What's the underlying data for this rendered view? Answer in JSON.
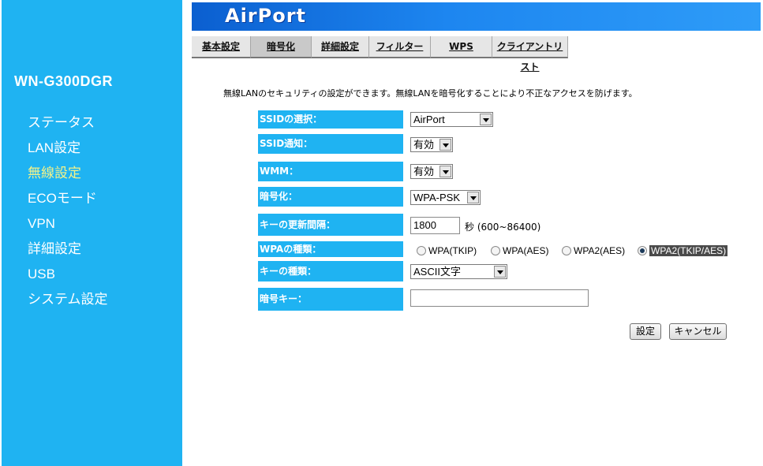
{
  "sidebar": {
    "model": "WN-G300DGR",
    "items": [
      {
        "label": "ステータス"
      },
      {
        "label": "LAN設定"
      },
      {
        "label": "無線設定"
      },
      {
        "label": "ECOモード"
      },
      {
        "label": "VPN"
      },
      {
        "label": "詳細設定"
      },
      {
        "label": "USB"
      },
      {
        "label": "システム設定"
      }
    ],
    "active_index": 2,
    "active_color": "#f2f28a",
    "background_color": "#1fb3f2"
  },
  "header": {
    "logo": "AirPort"
  },
  "tabs": [
    {
      "label": "基本設定"
    },
    {
      "label": "暗号化"
    },
    {
      "label": "詳細設定"
    },
    {
      "label": "フィルター"
    },
    {
      "label": "WPS"
    },
    {
      "label": "クライアントリスト"
    }
  ],
  "active_tab": 1,
  "description": "無線LANのセキュリティの設定ができます。無線LANを暗号化することにより不正なアクセスを防げます。",
  "form": {
    "ssid_select": {
      "label": "SSIDの選択：",
      "value": "AirPort"
    },
    "ssid_broadcast": {
      "label": "SSID通知：",
      "value": "有効"
    },
    "wmm": {
      "label": "WMM：",
      "value": "有効"
    },
    "encryption": {
      "label": "暗号化：",
      "value": "WPA-PSK"
    },
    "key_interval": {
      "label": "キーの更新間隔：",
      "value": "1800",
      "unit": "秒 (600~86400)"
    },
    "wpa_type": {
      "label": "WPAの種類：",
      "options": [
        "WPA(TKIP)",
        "WPA(AES)",
        "WPA2(AES)",
        "WPA2(TKIP/AES)"
      ],
      "selected": "WPA2(TKIP/AES)"
    },
    "key_type": {
      "label": "キーの種類：",
      "value": "ASCII文字"
    },
    "passphrase": {
      "label": "暗号キー：",
      "value": ""
    }
  },
  "buttons": {
    "save": "設定",
    "cancel": "キャンセル"
  }
}
